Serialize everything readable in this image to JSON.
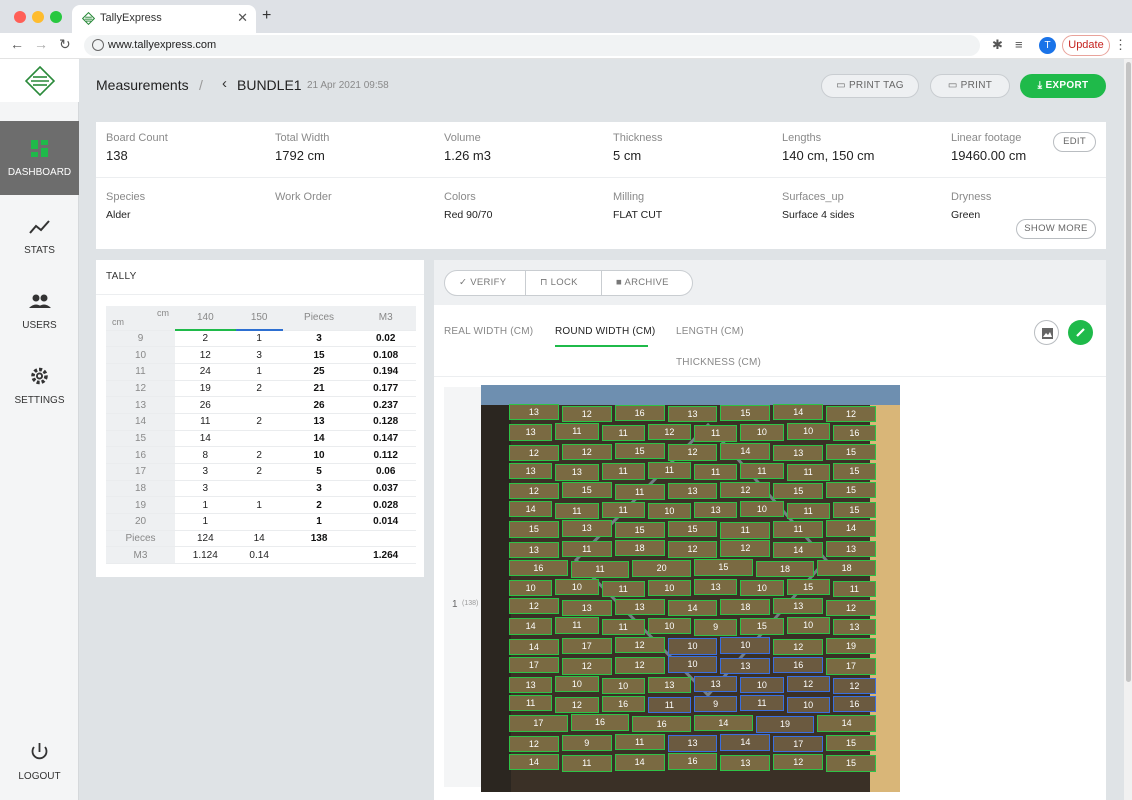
{
  "browser": {
    "tab_title": "TallyExpress",
    "url": "www.tallyexpress.com",
    "avatar_letter": "T",
    "update_label": "Update"
  },
  "sidebar": {
    "items": [
      {
        "label": "DASHBOARD",
        "icon": "dashboard-grid-icon",
        "active": true
      },
      {
        "label": "STATS",
        "icon": "trend-line-icon"
      },
      {
        "label": "USERS",
        "icon": "users-icon"
      },
      {
        "label": "SETTINGS",
        "icon": "gear-icon"
      }
    ],
    "logout": "LOGOUT"
  },
  "header": {
    "section": "Measurements",
    "separator": "/",
    "bundle": "BUNDLE1",
    "date": "21 Apr 2021 09:58",
    "print_tag": "PRINT TAG",
    "print": "PRINT",
    "export": "EXPORT"
  },
  "info": {
    "row1": [
      {
        "label": "Board Count",
        "value": "138"
      },
      {
        "label": "Total Width",
        "value": "1792 cm"
      },
      {
        "label": "Volume",
        "value": "1.26 m3"
      },
      {
        "label": "Thickness",
        "value": "5 cm"
      },
      {
        "label": "Lengths",
        "value": "140 cm, 150 cm"
      },
      {
        "label": "Linear footage",
        "value": "19460.00 cm"
      }
    ],
    "row2": [
      {
        "label": "Species",
        "value": "Alder"
      },
      {
        "label": "Work Order",
        "value": ""
      },
      {
        "label": "Colors",
        "value": "Red 90/70"
      },
      {
        "label": "Milling",
        "value": "FLAT CUT"
      },
      {
        "label": "Surfaces_up",
        "value": "Surface 4 sides"
      },
      {
        "label": "Dryness",
        "value": "Green"
      }
    ],
    "edit": "EDIT",
    "show_more": "SHOW MORE"
  },
  "tally": {
    "title": "TALLY",
    "corner_top": "cm",
    "corner_bottom": "cm",
    "headers": [
      "140",
      "150",
      "Pieces",
      "M3"
    ],
    "rows": [
      [
        "9",
        "2",
        "1",
        "3",
        "0.02"
      ],
      [
        "10",
        "12",
        "3",
        "15",
        "0.108"
      ],
      [
        "11",
        "24",
        "1",
        "25",
        "0.194"
      ],
      [
        "12",
        "19",
        "2",
        "21",
        "0.177"
      ],
      [
        "13",
        "26",
        "",
        "26",
        "0.237"
      ],
      [
        "14",
        "11",
        "2",
        "13",
        "0.128"
      ],
      [
        "15",
        "14",
        "",
        "14",
        "0.147"
      ],
      [
        "16",
        "8",
        "2",
        "10",
        "0.112"
      ],
      [
        "17",
        "3",
        "2",
        "5",
        "0.06"
      ],
      [
        "18",
        "3",
        "",
        "3",
        "0.037"
      ],
      [
        "19",
        "1",
        "1",
        "2",
        "0.028"
      ],
      [
        "20",
        "1",
        "",
        "1",
        "0.014"
      ],
      [
        "Pieces",
        "124",
        "14",
        "138",
        ""
      ],
      [
        "M3",
        "1.124",
        "0.14",
        "",
        "1.264"
      ]
    ]
  },
  "actions": {
    "verify": "VERIFY",
    "lock": "LOCK",
    "archive": "ARCHIVE"
  },
  "measure_tabs": {
    "real_width": "REAL WIDTH (CM)",
    "round_width": "ROUND WIDTH (CM)",
    "length": "LENGTH (CM)",
    "thickness": "THICKNESS (CM)"
  },
  "photo": {
    "row_label": "1",
    "row_count": "(138)",
    "rows": [
      [
        "13",
        "12",
        "16",
        "13",
        "15",
        "14",
        "12"
      ],
      [
        "13",
        "11",
        "11",
        "12",
        "11",
        "10",
        "10",
        "16"
      ],
      [
        "12",
        "12",
        "15",
        "12",
        "14",
        "13",
        "15"
      ],
      [
        "13",
        "13",
        "11",
        "11",
        "11",
        "11",
        "11",
        "15"
      ],
      [
        "12",
        "15",
        "11",
        "13",
        "12",
        "15",
        "15"
      ],
      [
        "14",
        "11",
        "11",
        "10",
        "13",
        "10",
        "11",
        "15"
      ],
      [
        "15",
        "13",
        "15",
        "15",
        "11",
        "11",
        "14"
      ],
      [
        "13",
        "11",
        "18",
        "12",
        "12",
        "14",
        "13"
      ],
      [
        "16",
        "11",
        "20",
        "15",
        "18",
        "18"
      ],
      [
        "10",
        "10",
        "11",
        "10",
        "13",
        "10",
        "15",
        "11"
      ],
      [
        "12",
        "13",
        "13",
        "14",
        "18",
        "13",
        "12"
      ],
      [
        "14",
        "11",
        "11",
        "10",
        "9",
        "15",
        "10",
        "13"
      ],
      [
        "14",
        "17",
        "12",
        "10",
        "10",
        "12",
        "19"
      ],
      [
        "17",
        "12",
        "12",
        "10",
        "13",
        "16",
        "17"
      ],
      [
        "13",
        "10",
        "10",
        "13",
        "13",
        "10",
        "12",
        "12"
      ],
      [
        "11",
        "12",
        "16",
        "11",
        "9",
        "11",
        "10",
        "16"
      ],
      [
        "17",
        "16",
        "16",
        "14",
        "19",
        "14"
      ],
      [
        "12",
        "9",
        "11",
        "13",
        "14",
        "17",
        "15"
      ],
      [
        "14",
        "11",
        "14",
        "16",
        "13",
        "12",
        "15"
      ]
    ],
    "blue_cells": [
      "12-3",
      "12-4",
      "13-3",
      "13-4",
      "13-5",
      "14-4",
      "14-5",
      "14-6",
      "14-7",
      "15-3",
      "15-4",
      "15-5",
      "15-6",
      "15-7",
      "16-4",
      "17-3",
      "17-4",
      "17-5"
    ]
  }
}
